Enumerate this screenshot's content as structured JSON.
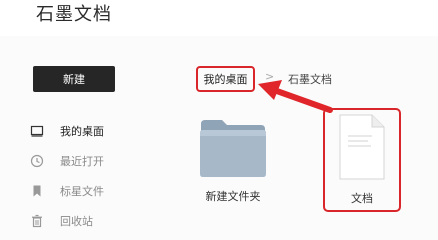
{
  "app": {
    "title": "石墨文档"
  },
  "sidebar": {
    "new_button": "新建",
    "items": [
      {
        "label": "我的桌面",
        "icon": "desktop-icon",
        "active": true
      },
      {
        "label": "最近打开",
        "icon": "clock-icon",
        "active": false
      },
      {
        "label": "标星文件",
        "icon": "bookmark-icon",
        "active": false
      },
      {
        "label": "回收站",
        "icon": "trash-icon",
        "active": false
      }
    ]
  },
  "breadcrumb": {
    "root": "我的桌面",
    "separator": ">",
    "current": "石墨文档"
  },
  "files": [
    {
      "name": "新建文件夹",
      "icon": "folder-icon"
    },
    {
      "name": "文档",
      "icon": "document-icon"
    }
  ],
  "colors": {
    "highlight": "#d9262b",
    "new_button_bg": "#262626"
  }
}
